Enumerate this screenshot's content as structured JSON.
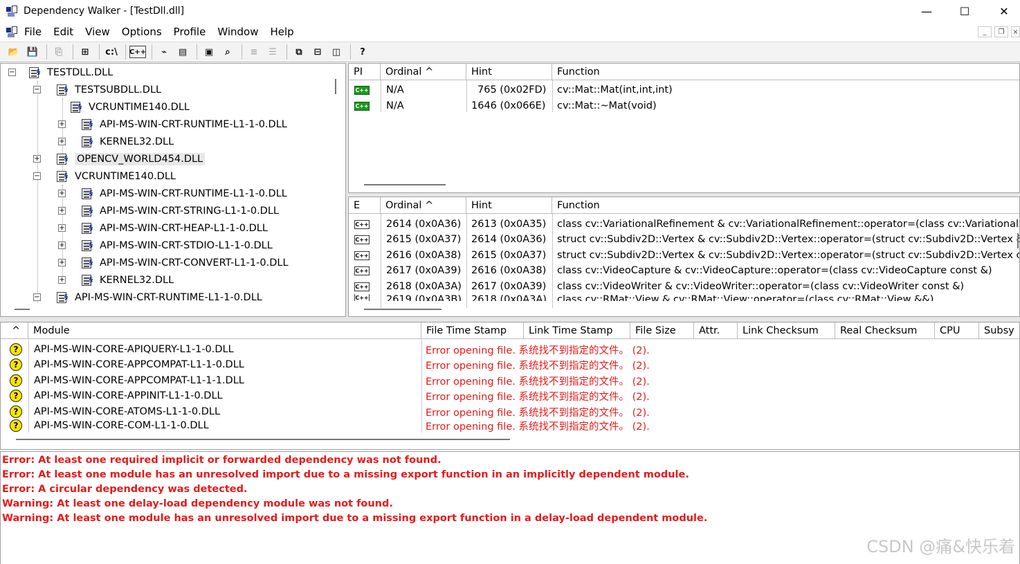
{
  "window": {
    "title": "Dependency Walker - [TestDll.dll]",
    "buttons": {
      "minimize": "—",
      "maximize": "☐",
      "close": "✕"
    }
  },
  "menu": [
    "File",
    "Edit",
    "View",
    "Options",
    "Profile",
    "Window",
    "Help"
  ],
  "toolbar": {
    "items": [
      "open-icon",
      "save-icon",
      "copy-icon",
      "expand-icon",
      "path-icon",
      "cpp-icon",
      "graph-icon",
      "props-icon",
      "print-icon",
      "search-icon",
      "list-icon",
      "list2-icon",
      "cascade-icon",
      "tile-h-icon",
      "tile-v-icon",
      "help-icon"
    ],
    "path_label": "c:\\",
    "cpp_label": "C++",
    "help_label": "?"
  },
  "tree": {
    "root": "TESTDLL.DLL",
    "nodes": [
      {
        "label": "TESTSUBDLL.DLL"
      },
      {
        "label": "VCRUNTIME140.DLL"
      },
      {
        "label": "API-MS-WIN-CRT-RUNTIME-L1-1-0.DLL"
      },
      {
        "label": "KERNEL32.DLL"
      },
      {
        "label": "OPENCV_WORLD454.DLL"
      },
      {
        "label": "VCRUNTIME140.DLL"
      },
      {
        "label": "API-MS-WIN-CRT-RUNTIME-L1-1-0.DLL"
      },
      {
        "label": "API-MS-WIN-CRT-STRING-L1-1-0.DLL"
      },
      {
        "label": "API-MS-WIN-CRT-HEAP-L1-1-0.DLL"
      },
      {
        "label": "API-MS-WIN-CRT-STDIO-L1-1-0.DLL"
      },
      {
        "label": "API-MS-WIN-CRT-CONVERT-L1-1-0.DLL"
      },
      {
        "label": "KERNEL32.DLL"
      },
      {
        "label": "API-MS-WIN-CRT-RUNTIME-L1-1-0.DLL"
      }
    ]
  },
  "imports": {
    "headers": [
      "PI",
      "Ordinal ^",
      "Hint",
      "Function"
    ],
    "rows": [
      {
        "ordinal": "N/A",
        "hint": "765 (0x02FD)",
        "function": "cv::Mat::Mat(int,int,int)"
      },
      {
        "ordinal": "N/A",
        "hint": "1646 (0x066E)",
        "function": "cv::Mat::~Mat(void)"
      }
    ]
  },
  "exports": {
    "headers": [
      "E",
      "Ordinal ^",
      "Hint",
      "Function"
    ],
    "rows": [
      {
        "ordinal": "2614 (0x0A36)",
        "hint": "2613 (0x0A35)",
        "function": "class cv::VariationalRefinement & cv::VariationalRefinement::operator=(class cv::Variational"
      },
      {
        "ordinal": "2615 (0x0A37)",
        "hint": "2614 (0x0A36)",
        "function": "struct cv::Subdiv2D::Vertex & cv::Subdiv2D::Vertex::operator=(struct cv::Subdiv2D::Vertex &"
      },
      {
        "ordinal": "2616 (0x0A38)",
        "hint": "2615 (0x0A37)",
        "function": "struct cv::Subdiv2D::Vertex & cv::Subdiv2D::Vertex::operator=(struct cv::Subdiv2D::Vertex cc"
      },
      {
        "ordinal": "2617 (0x0A39)",
        "hint": "2616 (0x0A38)",
        "function": "class cv::VideoCapture & cv::VideoCapture::operator=(class cv::VideoCapture const &)"
      },
      {
        "ordinal": "2618 (0x0A3A)",
        "hint": "2617 (0x0A39)",
        "function": "class cv::VideoWriter & cv::VideoWriter::operator=(class cv::VideoWriter const &)"
      },
      {
        "ordinal": "2619 (0x0A3B)",
        "hint": "2618 (0x0A3A)",
        "function": "class cv::RMat::View & cv::RMat::View::operator=(class cv::RMat::View &&)"
      }
    ]
  },
  "modules": {
    "headers": [
      "^",
      "Module",
      "File Time Stamp",
      "Link Time Stamp",
      "File Size",
      "Attr.",
      "Link Checksum",
      "Real Checksum",
      "CPU",
      "Subsy"
    ],
    "rows": [
      {
        "module": "API-MS-WIN-CORE-APIQUERY-L1-1-0.DLL",
        "status": "Error opening file. 系统找不到指定的文件。 (2)."
      },
      {
        "module": "API-MS-WIN-CORE-APPCOMPAT-L1-1-0.DLL",
        "status": "Error opening file. 系统找不到指定的文件。 (2)."
      },
      {
        "module": "API-MS-WIN-CORE-APPCOMPAT-L1-1-1.DLL",
        "status": "Error opening file. 系统找不到指定的文件。 (2)."
      },
      {
        "module": "API-MS-WIN-CORE-APPINIT-L1-1-0.DLL",
        "status": "Error opening file. 系统找不到指定的文件。 (2)."
      },
      {
        "module": "API-MS-WIN-CORE-ATOMS-L1-1-0.DLL",
        "status": "Error opening file. 系统找不到指定的文件。 (2)."
      },
      {
        "module": "API-MS-WIN-CORE-COM-L1-1-0.DLL",
        "status": "Error opening file. 系统找不到指定的文件。 (2)."
      }
    ]
  },
  "log": [
    "Error: At least one required implicit or forwarded dependency was not found.",
    "Error: At least one module has an unresolved import due to a missing export function in an implicitly dependent module.",
    "Error: A circular dependency was detected.",
    "Warning: At least one delay-load dependency module was not found.",
    "Warning: At least one module has an unresolved import due to a missing export function in a delay-load dependent module."
  ],
  "watermark": "CSDN @痛&快乐着",
  "colors": {
    "error": "#e81a1a",
    "cpp_green": "#1c9a1c",
    "question": "#ffe400"
  }
}
